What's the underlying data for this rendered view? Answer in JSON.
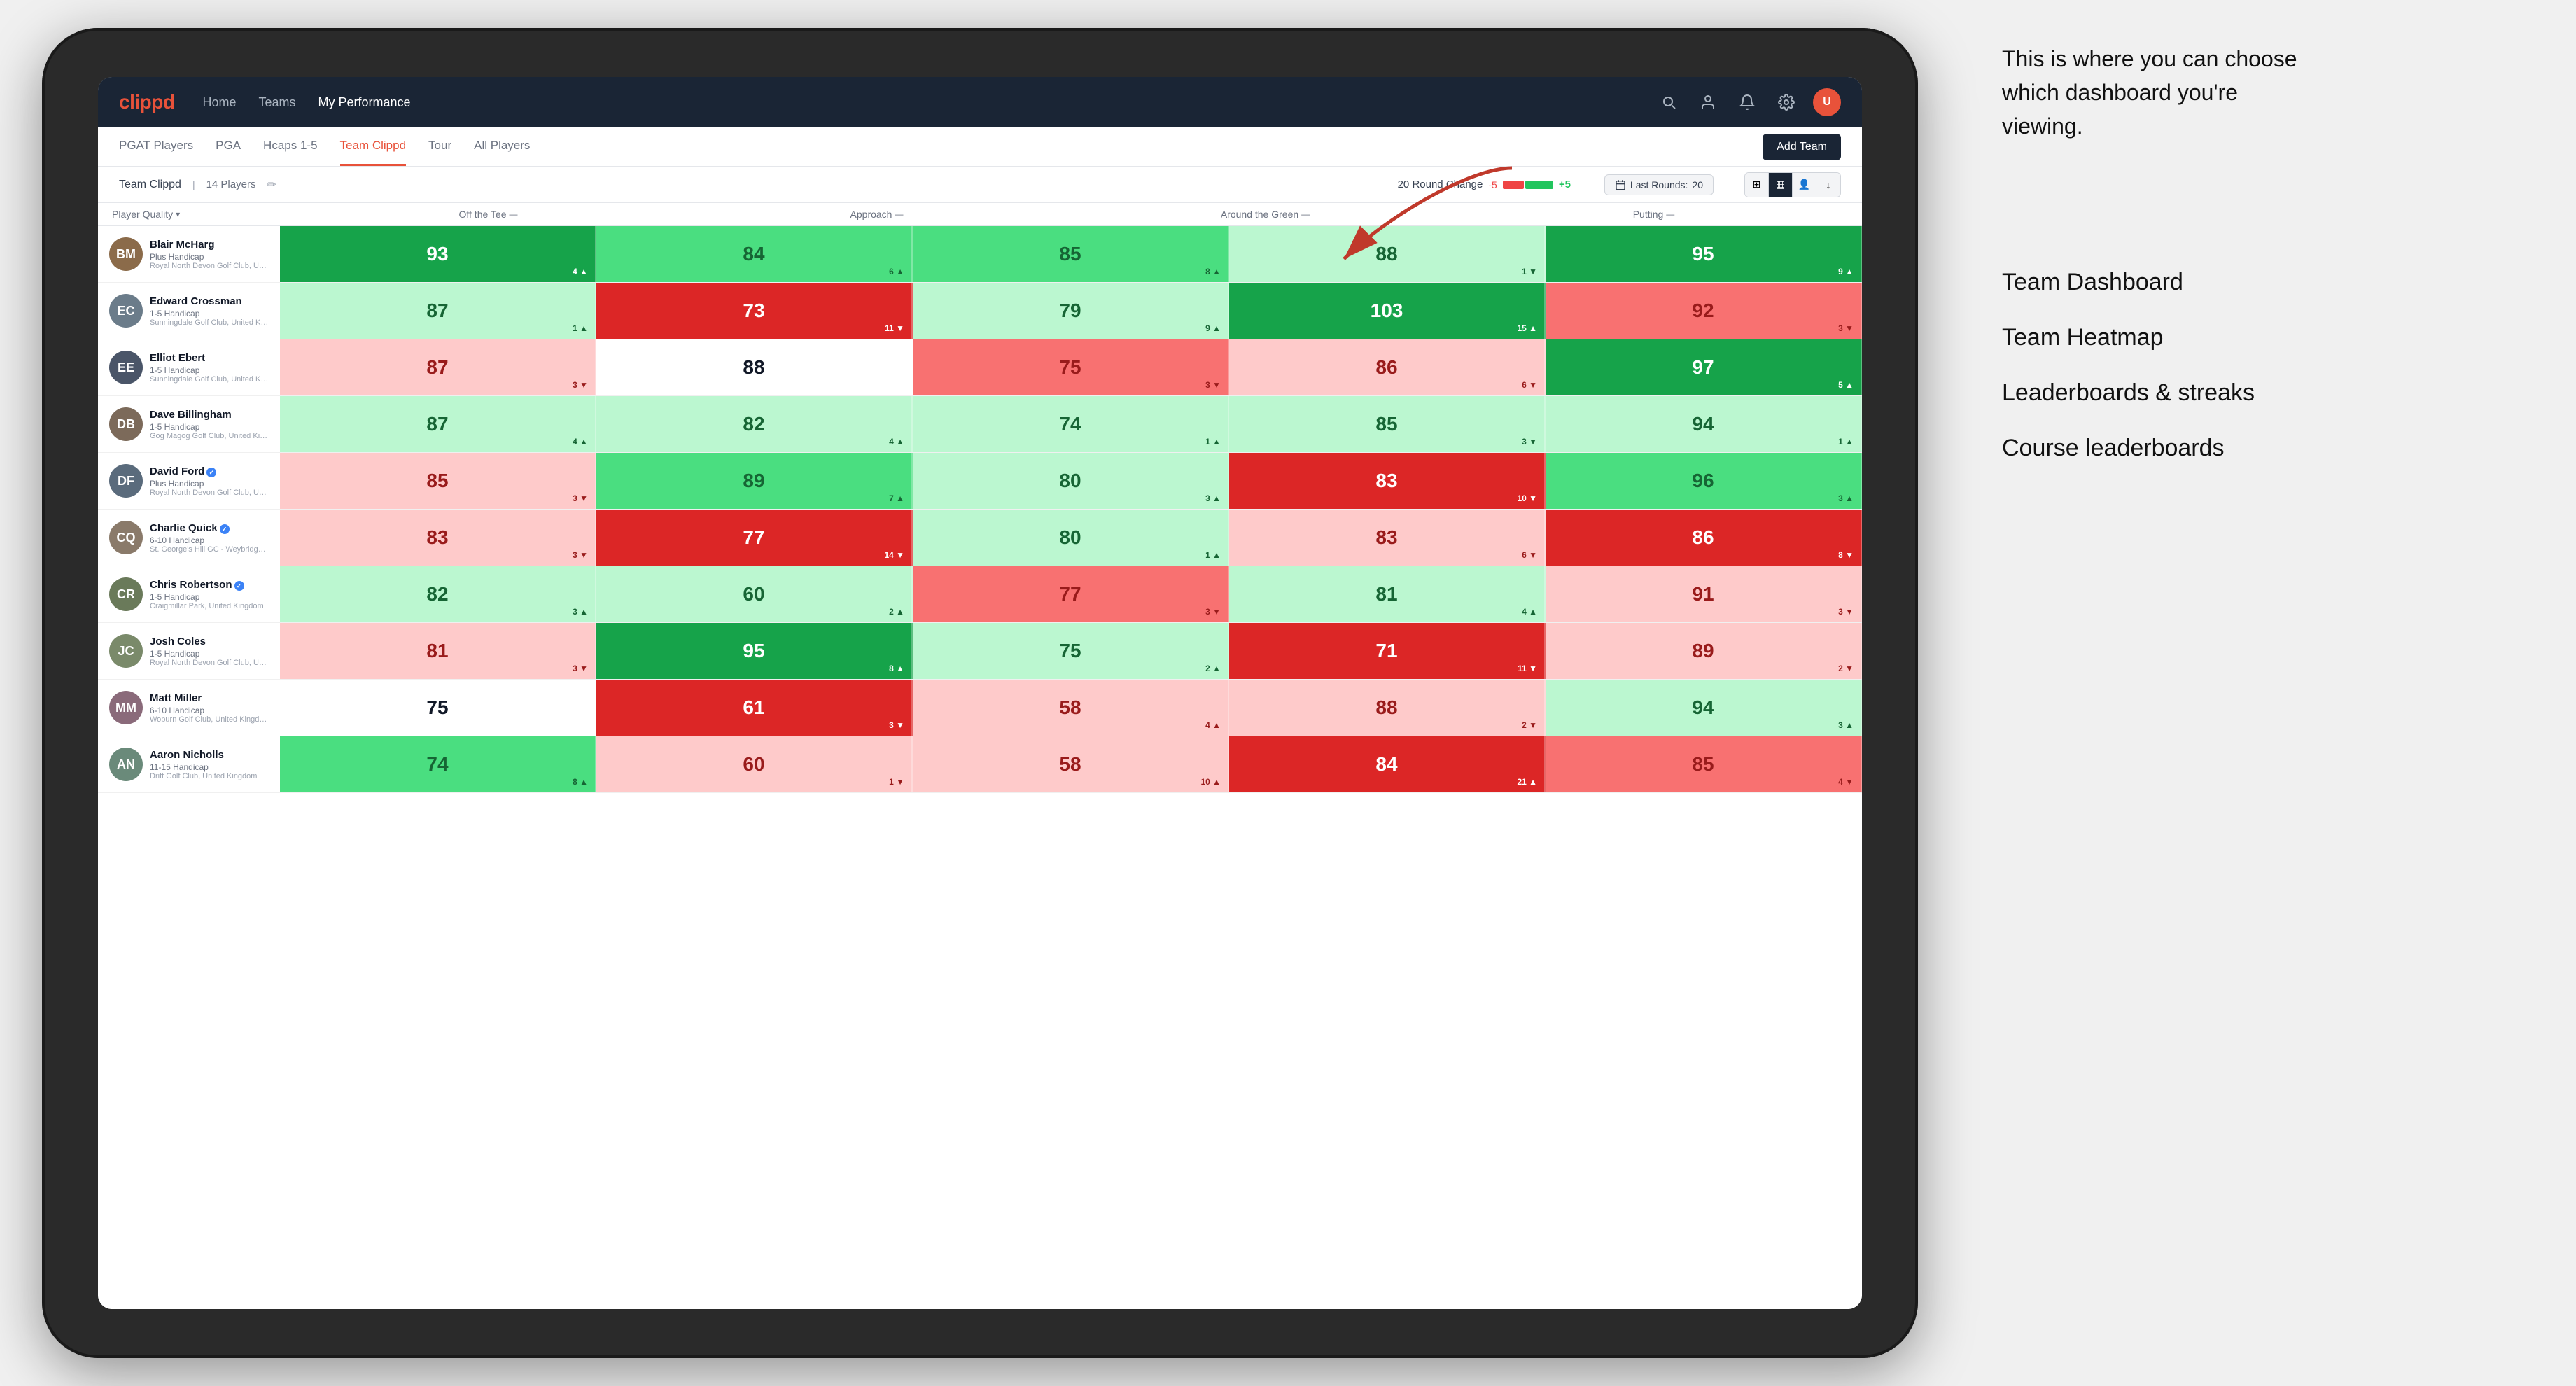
{
  "annotation": {
    "intro_text": "This is where you can choose which dashboard you're viewing.",
    "menu_items": [
      "Team Dashboard",
      "Team Heatmap",
      "Leaderboards & streaks",
      "Course leaderboards"
    ]
  },
  "nav": {
    "logo": "clippd",
    "links": [
      {
        "label": "Home",
        "active": false
      },
      {
        "label": "Teams",
        "active": false
      },
      {
        "label": "My Performance",
        "active": true
      }
    ]
  },
  "sub_nav": {
    "links": [
      {
        "label": "PGAT Players",
        "active": false
      },
      {
        "label": "PGA",
        "active": false
      },
      {
        "label": "Hcaps 1-5",
        "active": false
      },
      {
        "label": "Team Clippd",
        "active": true
      },
      {
        "label": "Tour",
        "active": false
      },
      {
        "label": "All Players",
        "active": false
      }
    ],
    "add_team_label": "Add Team"
  },
  "team_header": {
    "name": "Team Clippd",
    "separator": "|",
    "count": "14 Players",
    "round_change_label": "20 Round Change",
    "round_minus": "-5",
    "round_plus": "+5",
    "last_rounds_label": "Last Rounds:",
    "last_rounds_value": "20"
  },
  "columns": {
    "player_quality": "Player Quality",
    "off_tee": "Off the Tee",
    "approach": "Approach",
    "around_green": "Around the Green",
    "putting": "Putting"
  },
  "players": [
    {
      "name": "Blair McHarg",
      "handicap": "Plus Handicap",
      "club": "Royal North Devon Golf Club, United Kingdom",
      "initials": "BM",
      "avatar_color": "#8b6b4a",
      "scores": [
        {
          "value": "93",
          "delta": "4",
          "dir": "up",
          "bg": "dark-green"
        },
        {
          "value": "84",
          "delta": "6",
          "dir": "up",
          "bg": "mid-green"
        },
        {
          "value": "85",
          "delta": "8",
          "dir": "up",
          "bg": "mid-green"
        },
        {
          "value": "88",
          "delta": "1",
          "dir": "down",
          "bg": "light-green"
        },
        {
          "value": "95",
          "delta": "9",
          "dir": "up",
          "bg": "dark-green"
        }
      ]
    },
    {
      "name": "Edward Crossman",
      "handicap": "1-5 Handicap",
      "club": "Sunningdale Golf Club, United Kingdom",
      "initials": "EC",
      "avatar_color": "#6b7c8a",
      "scores": [
        {
          "value": "87",
          "delta": "1",
          "dir": "up",
          "bg": "light-green"
        },
        {
          "value": "73",
          "delta": "11",
          "dir": "down",
          "bg": "dark-red"
        },
        {
          "value": "79",
          "delta": "9",
          "dir": "up",
          "bg": "light-green"
        },
        {
          "value": "103",
          "delta": "15",
          "dir": "up",
          "bg": "dark-green"
        },
        {
          "value": "92",
          "delta": "3",
          "dir": "down",
          "bg": "mid-red"
        }
      ]
    },
    {
      "name": "Elliot Ebert",
      "handicap": "1-5 Handicap",
      "club": "Sunningdale Golf Club, United Kingdom",
      "initials": "EE",
      "avatar_color": "#4a5568",
      "scores": [
        {
          "value": "87",
          "delta": "3",
          "dir": "down",
          "bg": "light-red"
        },
        {
          "value": "88",
          "delta": "",
          "dir": "neutral",
          "bg": "white"
        },
        {
          "value": "75",
          "delta": "3",
          "dir": "down",
          "bg": "mid-red"
        },
        {
          "value": "86",
          "delta": "6",
          "dir": "down",
          "bg": "light-red"
        },
        {
          "value": "97",
          "delta": "5",
          "dir": "up",
          "bg": "dark-green"
        }
      ]
    },
    {
      "name": "Dave Billingham",
      "handicap": "1-5 Handicap",
      "club": "Gog Magog Golf Club, United Kingdom",
      "initials": "DB",
      "avatar_color": "#7c6a5a",
      "scores": [
        {
          "value": "87",
          "delta": "4",
          "dir": "up",
          "bg": "light-green"
        },
        {
          "value": "82",
          "delta": "4",
          "dir": "up",
          "bg": "light-green"
        },
        {
          "value": "74",
          "delta": "1",
          "dir": "up",
          "bg": "light-green"
        },
        {
          "value": "85",
          "delta": "3",
          "dir": "down",
          "bg": "light-green"
        },
        {
          "value": "94",
          "delta": "1",
          "dir": "up",
          "bg": "light-green"
        }
      ]
    },
    {
      "name": "David Ford",
      "handicap": "Plus Handicap",
      "club": "Royal North Devon Golf Club, United Kingdom",
      "initials": "DF",
      "avatar_color": "#5a6b7c",
      "verified": true,
      "scores": [
        {
          "value": "85",
          "delta": "3",
          "dir": "down",
          "bg": "light-red"
        },
        {
          "value": "89",
          "delta": "7",
          "dir": "up",
          "bg": "mid-green"
        },
        {
          "value": "80",
          "delta": "3",
          "dir": "up",
          "bg": "light-green"
        },
        {
          "value": "83",
          "delta": "10",
          "dir": "down",
          "bg": "dark-red"
        },
        {
          "value": "96",
          "delta": "3",
          "dir": "up",
          "bg": "mid-green"
        }
      ]
    },
    {
      "name": "Charlie Quick",
      "handicap": "6-10 Handicap",
      "club": "St. George's Hill GC - Weybridge - Surrey, Uni...",
      "initials": "CQ",
      "avatar_color": "#8a7a6a",
      "verified": true,
      "scores": [
        {
          "value": "83",
          "delta": "3",
          "dir": "down",
          "bg": "light-red"
        },
        {
          "value": "77",
          "delta": "14",
          "dir": "down",
          "bg": "dark-red"
        },
        {
          "value": "80",
          "delta": "1",
          "dir": "up",
          "bg": "light-green"
        },
        {
          "value": "83",
          "delta": "6",
          "dir": "down",
          "bg": "light-red"
        },
        {
          "value": "86",
          "delta": "8",
          "dir": "down",
          "bg": "dark-red"
        }
      ]
    },
    {
      "name": "Chris Robertson",
      "handicap": "1-5 Handicap",
      "club": "Craigmillar Park, United Kingdom",
      "initials": "CR",
      "avatar_color": "#6a7a5a",
      "verified": true,
      "scores": [
        {
          "value": "82",
          "delta": "3",
          "dir": "up",
          "bg": "light-green"
        },
        {
          "value": "60",
          "delta": "2",
          "dir": "up",
          "bg": "light-green"
        },
        {
          "value": "77",
          "delta": "3",
          "dir": "down",
          "bg": "mid-red"
        },
        {
          "value": "81",
          "delta": "4",
          "dir": "up",
          "bg": "light-green"
        },
        {
          "value": "91",
          "delta": "3",
          "dir": "down",
          "bg": "light-red"
        }
      ]
    },
    {
      "name": "Josh Coles",
      "handicap": "1-5 Handicap",
      "club": "Royal North Devon Golf Club, United Kingdom",
      "initials": "JC",
      "avatar_color": "#7a8a6a",
      "scores": [
        {
          "value": "81",
          "delta": "3",
          "dir": "down",
          "bg": "light-red"
        },
        {
          "value": "95",
          "delta": "8",
          "dir": "up",
          "bg": "dark-green"
        },
        {
          "value": "75",
          "delta": "2",
          "dir": "up",
          "bg": "light-green"
        },
        {
          "value": "71",
          "delta": "11",
          "dir": "down",
          "bg": "dark-red"
        },
        {
          "value": "89",
          "delta": "2",
          "dir": "down",
          "bg": "light-red"
        }
      ]
    },
    {
      "name": "Matt Miller",
      "handicap": "6-10 Handicap",
      "club": "Woburn Golf Club, United Kingdom",
      "initials": "MM",
      "avatar_color": "#8a6a7a",
      "scores": [
        {
          "value": "75",
          "delta": "",
          "dir": "neutral",
          "bg": "white"
        },
        {
          "value": "61",
          "delta": "3",
          "dir": "down",
          "bg": "dark-red"
        },
        {
          "value": "58",
          "delta": "4",
          "dir": "up",
          "bg": "light-red"
        },
        {
          "value": "88",
          "delta": "2",
          "dir": "down",
          "bg": "light-red"
        },
        {
          "value": "94",
          "delta": "3",
          "dir": "up",
          "bg": "light-green"
        }
      ]
    },
    {
      "name": "Aaron Nicholls",
      "handicap": "11-15 Handicap",
      "club": "Drift Golf Club, United Kingdom",
      "initials": "AN",
      "avatar_color": "#6a8a7a",
      "scores": [
        {
          "value": "74",
          "delta": "8",
          "dir": "up",
          "bg": "mid-green"
        },
        {
          "value": "60",
          "delta": "1",
          "dir": "down",
          "bg": "light-red"
        },
        {
          "value": "58",
          "delta": "10",
          "dir": "up",
          "bg": "light-red"
        },
        {
          "value": "84",
          "delta": "21",
          "dir": "up",
          "bg": "dark-red"
        },
        {
          "value": "85",
          "delta": "4",
          "dir": "down",
          "bg": "mid-red"
        }
      ]
    }
  ]
}
